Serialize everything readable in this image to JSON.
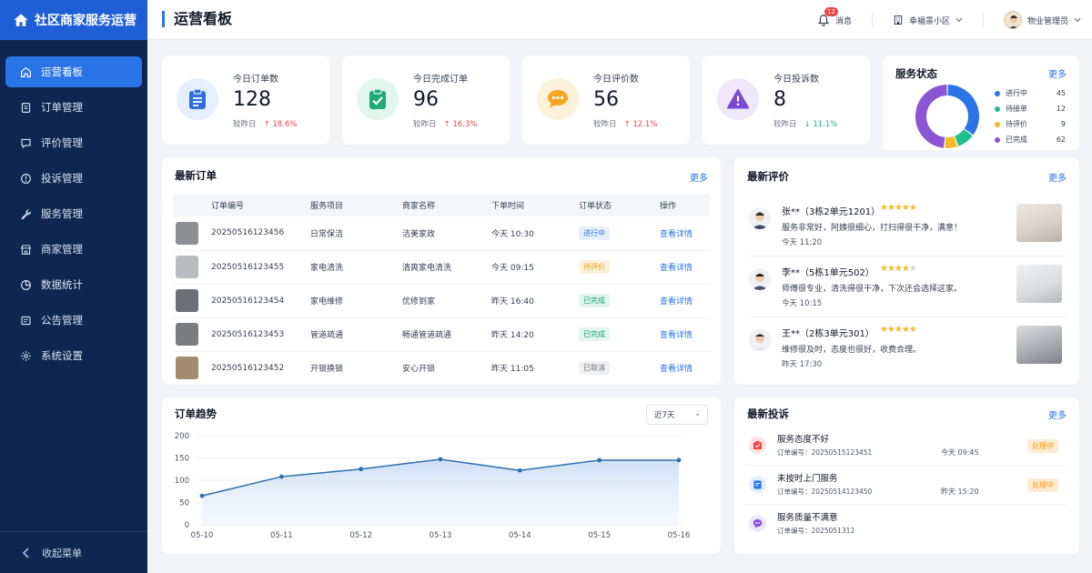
{
  "brand": {
    "name": "社区商家服务运营"
  },
  "sidebar": {
    "items": [
      {
        "label": "运营看板",
        "icon": "home-icon",
        "active": true
      },
      {
        "label": "订单管理",
        "icon": "order-icon"
      },
      {
        "label": "评价管理",
        "icon": "review-icon"
      },
      {
        "label": "投诉管理",
        "icon": "complaint-icon"
      },
      {
        "label": "服务管理",
        "icon": "wrench-icon"
      },
      {
        "label": "商家管理",
        "icon": "store-icon"
      },
      {
        "label": "数据统计",
        "icon": "chart-icon"
      },
      {
        "label": "公告管理",
        "icon": "notice-icon"
      },
      {
        "label": "系统设置",
        "icon": "gear-icon"
      }
    ],
    "collapse_label": "收起菜单"
  },
  "header": {
    "title": "运营看板",
    "message_label": "消息",
    "message_count": "12",
    "community": "幸福景小区",
    "user": "物业管理员"
  },
  "stats": [
    {
      "label": "今日订单数",
      "value": "128",
      "compare": "较昨日",
      "change": "↑ 18.6%",
      "trend": "up",
      "color": "#2f6fd8",
      "bg": "#e6effd"
    },
    {
      "label": "今日完成订单",
      "value": "96",
      "compare": "较昨日",
      "change": "↑ 16.3%",
      "trend": "up",
      "color": "#1faa78",
      "bg": "#e2f6ee"
    },
    {
      "label": "今日评价数",
      "value": "56",
      "compare": "较昨日",
      "change": "↑ 12.1%",
      "trend": "up",
      "color": "#f6a623",
      "bg": "#fdf1dc"
    },
    {
      "label": "今日投诉数",
      "value": "8",
      "compare": "较昨日",
      "change": "↓ 11.1%",
      "trend": "down",
      "color": "#7a4bd1",
      "bg": "#efe8fb"
    }
  ],
  "service_status": {
    "title": "服务状态",
    "more": "更多",
    "items": [
      {
        "label": "进行中",
        "value": 45,
        "color": "#2a74e8"
      },
      {
        "label": "待接单",
        "value": 12,
        "color": "#1fbf8f"
      },
      {
        "label": "待评价",
        "value": 9,
        "color": "#f6b928"
      },
      {
        "label": "已完成",
        "value": 62,
        "color": "#8b55d6"
      }
    ]
  },
  "orders": {
    "title": "最新订单",
    "more": "更多",
    "columns": [
      "订单编号",
      "服务项目",
      "商家名称",
      "下单时间",
      "订单状态",
      "操作"
    ],
    "rows": [
      {
        "id": "20250516123456",
        "service": "日常保洁",
        "merchant": "洁美家政",
        "time": "今天 10:30",
        "status": "进行中",
        "status_color": "#2a74e8",
        "status_bg": "#e6effd",
        "action": "查看详情",
        "thumb": "#8d8f95"
      },
      {
        "id": "20250516123455",
        "service": "家电清洗",
        "merchant": "清爽家电清洗",
        "time": "今天 09:15",
        "status": "待评价",
        "status_color": "#f59e0b",
        "status_bg": "#fdf1dc",
        "action": "查看详情",
        "thumb": "#b9bcc1"
      },
      {
        "id": "20250516123454",
        "service": "家电维修",
        "merchant": "优修到家",
        "time": "昨天 16:40",
        "status": "已完成",
        "status_color": "#10a36d",
        "status_bg": "#e2f6ee",
        "action": "查看详情",
        "thumb": "#6d7078"
      },
      {
        "id": "20250516123453",
        "service": "管道疏通",
        "merchant": "畅通管道疏通",
        "time": "昨天 14:20",
        "status": "已完成",
        "status_color": "#10a36d",
        "status_bg": "#e2f6ee",
        "action": "查看详情",
        "thumb": "#7c7d80"
      },
      {
        "id": "20250516123452",
        "service": "开锁换锁",
        "merchant": "安心开锁",
        "time": "昨天 11:05",
        "status": "已取消",
        "status_color": "#6b7280",
        "status_bg": "#f0f1f3",
        "action": "查看详情",
        "thumb": "#a58b6d"
      }
    ]
  },
  "reviews": {
    "title": "最新评价",
    "more": "更多",
    "items": [
      {
        "name": "张**（3栋2单元1201）",
        "stars": 5,
        "text": "服务非常好，阿姨很细心，打扫得很干净，满意！",
        "time": "今天 11:20",
        "photo": "#cfcac3"
      },
      {
        "name": "李**（5栋1单元502）",
        "stars": 4,
        "text": "师傅很专业，清洗得很干净，下次还会选择这家。",
        "time": "今天 10:15",
        "photo": "#d9dadd"
      },
      {
        "name": "王**（2栋3单元301）",
        "stars": 5,
        "text": "维修很及时，态度也很好，收费合理。",
        "time": "昨天 17:30",
        "photo": "#b7b9bd"
      }
    ]
  },
  "trend": {
    "title": "订单趋势",
    "range": "近7天"
  },
  "complaints": {
    "title": "最新投诉",
    "more": "更多",
    "items": [
      {
        "title": "服务态度不好",
        "order_no": "订单编号：20250515123451",
        "time": "今天 09:45",
        "status": "处理中",
        "icon_color": "#ef4444",
        "icon_bg": "#fde2e2"
      },
      {
        "title": "未按时上门服务",
        "order_no": "订单编号：20250514123450",
        "time": "昨天 15:20",
        "status": "处理中",
        "icon_color": "#2a74e8",
        "icon_bg": "#e6effd"
      },
      {
        "title": "服务质量不满意",
        "order_no": "订单编号：2025051312",
        "time": "",
        "status": "",
        "icon_color": "#8b55d6",
        "icon_bg": "#efe8fb"
      }
    ]
  },
  "chart_data": {
    "type": "line",
    "categories": [
      "05-10",
      "05-11",
      "05-12",
      "05-13",
      "05-14",
      "05-15",
      "05-16"
    ],
    "values": [
      65,
      108,
      125,
      147,
      122,
      145,
      145
    ],
    "ylim": [
      0,
      200
    ],
    "yticks": [
      "0",
      "50",
      "100",
      "150",
      "200"
    ],
    "grid": true,
    "color": "#2f6fb0"
  }
}
